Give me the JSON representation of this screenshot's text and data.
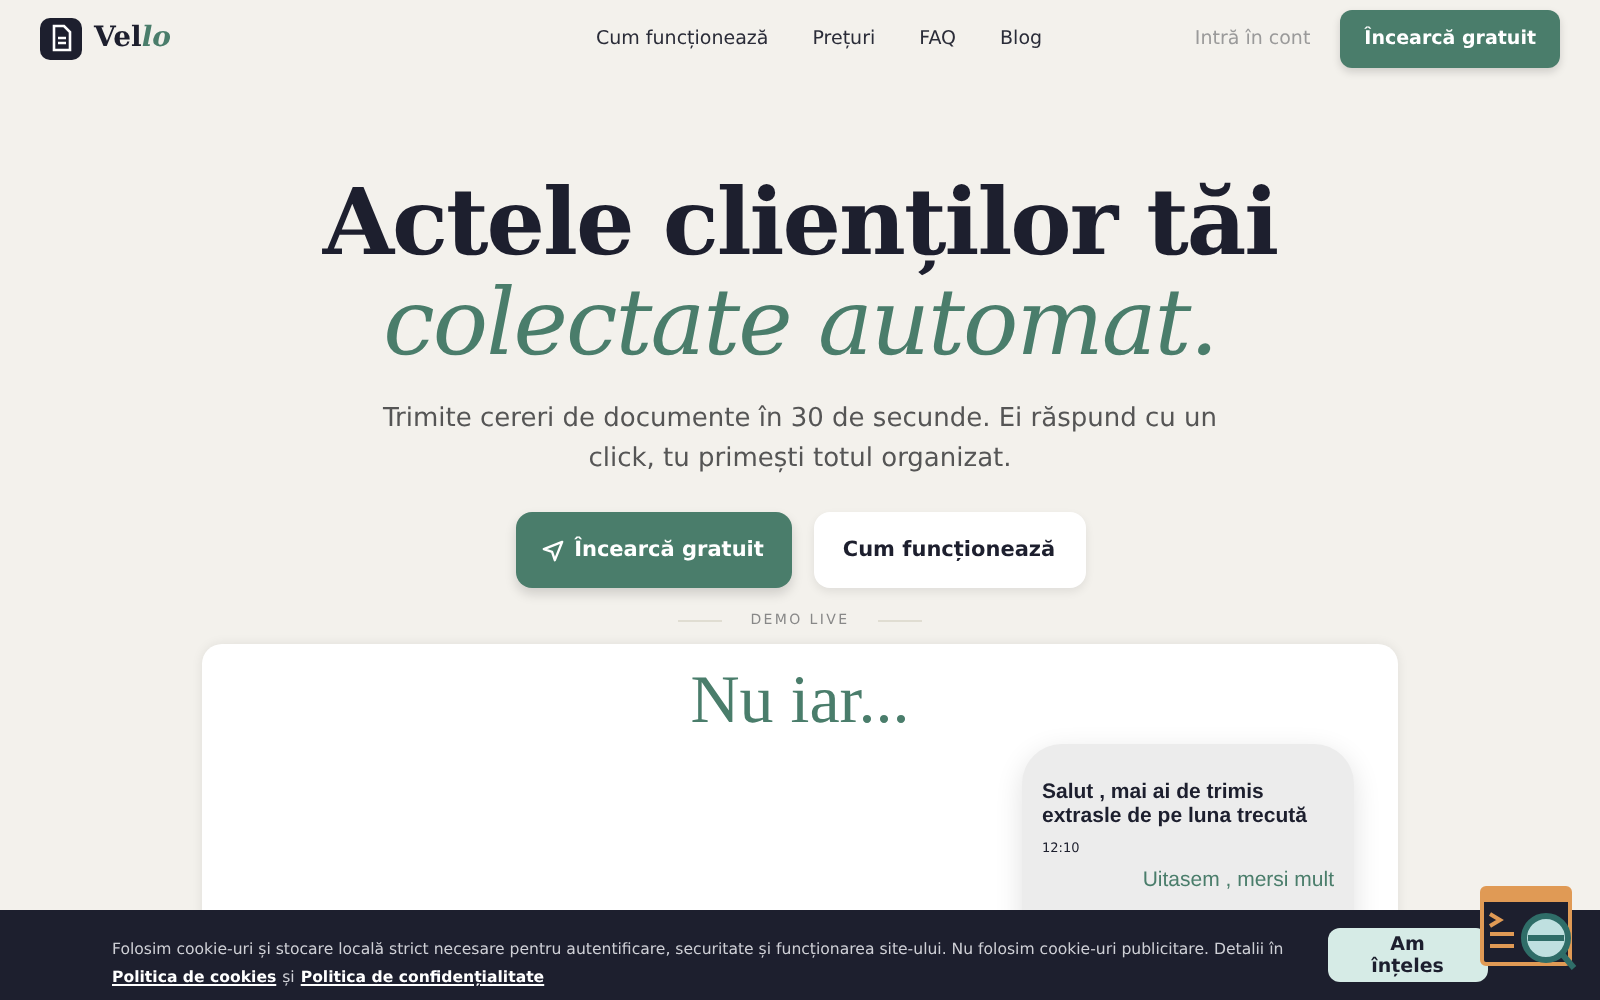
{
  "nav": {
    "logo": {
      "text": "Vel",
      "accent": "lo"
    },
    "links": [
      "Cum funcționează",
      "Prețuri",
      "FAQ",
      "Blog"
    ],
    "login": "Intră în cont",
    "cta": "Încearcă gratuit"
  },
  "hero": {
    "title": "Actele clienților tăi",
    "title_accent": "colectate automat.",
    "subtitle": "Trimite cereri de documente în 30 de secunde. Ei răspund cu un click, tu primești totul organizat.",
    "primary": "Încearcă gratuit",
    "secondary": "Cum funcționează",
    "demo_label": "DEMO LIVE"
  },
  "demo": {
    "heading": "Nu iar...",
    "message": "Salut , mai ai de trimis extrasle de pe luna trecută",
    "time": "12:10",
    "reply": "Uitasem , mersi mult"
  },
  "cookie": {
    "text": "Folosim cookie-uri și stocare locală strict necesare pentru autentificare, securitate și funcționarea site-ului. Nu folosim cookie-uri publicitare. Detalii în",
    "link1": "Politica de cookies",
    "joiner": "și",
    "link2": "Politica de confidențialitate",
    "button": "Am înțeles"
  }
}
